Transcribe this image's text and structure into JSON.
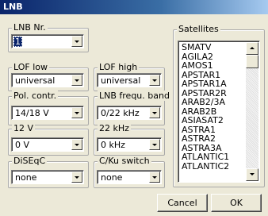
{
  "window": {
    "title": "LNB"
  },
  "lnb_nr": {
    "label": "LNB Nr.",
    "value": "1"
  },
  "lof_low": {
    "label": "LOF low",
    "value": "universal"
  },
  "lof_high": {
    "label": "LOF high",
    "value": "universal"
  },
  "pol_contr": {
    "label": "Pol. contr.",
    "value": "14/18 V"
  },
  "lnb_frequ_band": {
    "label": "LNB frequ. band",
    "value": "0/22 kHz"
  },
  "v12": {
    "label": "12 V",
    "value": "0 V"
  },
  "khz22": {
    "label": "22 kHz",
    "value": "0 kHz"
  },
  "diseqc": {
    "label": "DiSEqC",
    "value": "none"
  },
  "cku_switch": {
    "label": "C/Ku switch",
    "value": "none"
  },
  "satellites": {
    "label": "Satellites",
    "items": [
      "SMATV",
      "AGILA2",
      "AMOS1",
      "APSTAR1",
      "APSTAR1A",
      "APSTAR2R",
      "ARAB2/3A",
      "ARAB2B",
      "ASIASAT2",
      "ASTRA1",
      "ASTRA2",
      "ASTRA3A",
      "ATLANTIC1",
      "ATLANTIC2"
    ]
  },
  "buttons": {
    "cancel": "Cancel",
    "ok": "OK"
  }
}
